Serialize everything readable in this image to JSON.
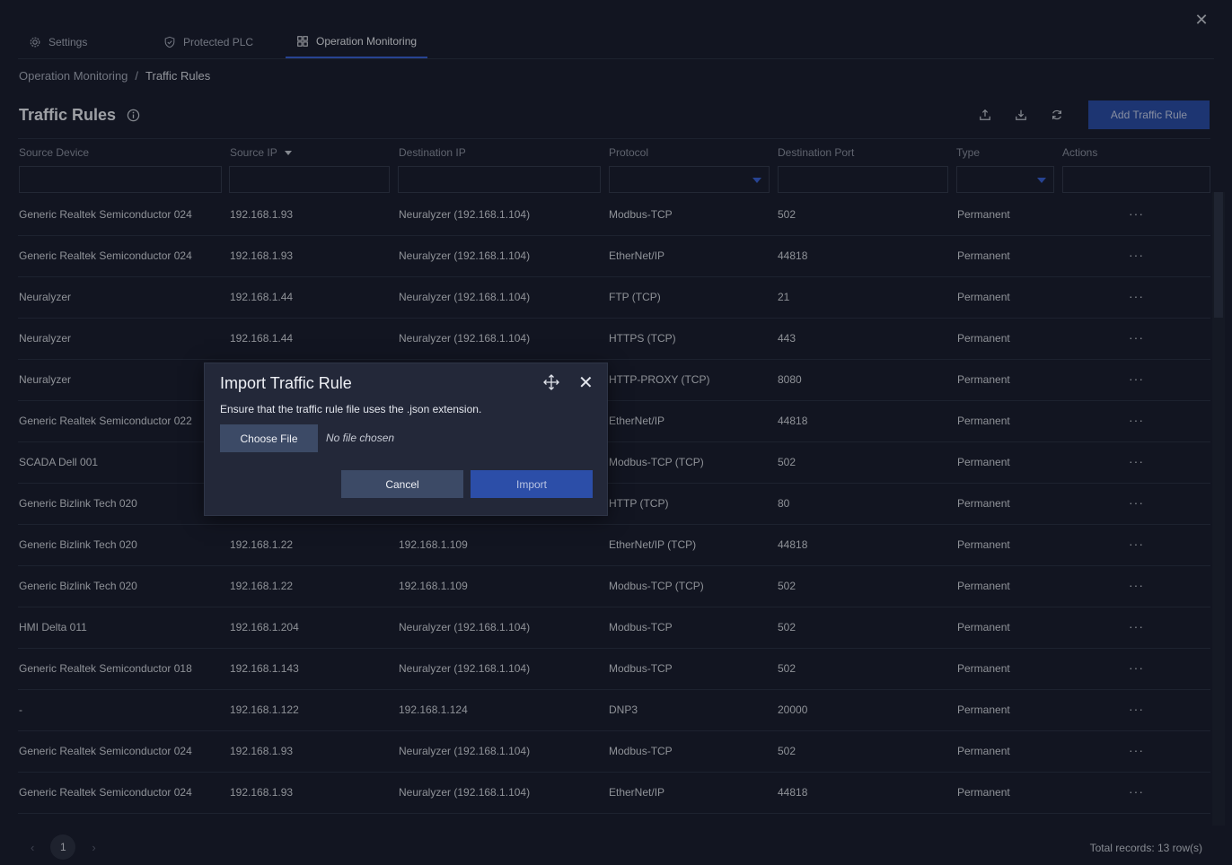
{
  "tabs": [
    {
      "label": "Settings",
      "icon": "gear-icon"
    },
    {
      "label": "Protected PLC",
      "icon": "shield-icon"
    },
    {
      "label": "Operation Monitoring",
      "icon": "grid-icon",
      "active": true
    }
  ],
  "breadcrumb": {
    "parent": "Operation Monitoring",
    "separator": "/",
    "current": "Traffic Rules"
  },
  "page_title": "Traffic Rules",
  "toolbar": {
    "add_label": "Add Traffic Rule",
    "icons": [
      "upload-icon",
      "download-icon",
      "refresh-icon"
    ]
  },
  "table": {
    "columns": [
      "Source Device",
      "Source IP",
      "Destination IP",
      "Protocol",
      "Destination Port",
      "Type",
      "Actions"
    ],
    "rows": [
      [
        "Generic Realtek Semiconductor 024",
        "192.168.1.93",
        "Neuralyzer (192.168.1.104)",
        "Modbus-TCP",
        "502",
        "Permanent"
      ],
      [
        "Generic Realtek Semiconductor 024",
        "192.168.1.93",
        "Neuralyzer (192.168.1.104)",
        "EtherNet/IP",
        "44818",
        "Permanent"
      ],
      [
        "Neuralyzer",
        "192.168.1.44",
        "Neuralyzer (192.168.1.104)",
        "FTP (TCP)",
        "21",
        "Permanent"
      ],
      [
        "Neuralyzer",
        "192.168.1.44",
        "Neuralyzer (192.168.1.104)",
        "HTTPS (TCP)",
        "443",
        "Permanent"
      ],
      [
        "Neuralyzer",
        "",
        "",
        "HTTP-PROXY (TCP)",
        "8080",
        "Permanent"
      ],
      [
        "Generic Realtek Semiconductor 022",
        "",
        "",
        "EtherNet/IP",
        "44818",
        "Permanent"
      ],
      [
        "SCADA Dell 001",
        "",
        "",
        "Modbus-TCP (TCP)",
        "502",
        "Permanent"
      ],
      [
        "Generic Bizlink Tech 020",
        "",
        "",
        "HTTP (TCP)",
        "80",
        "Permanent"
      ],
      [
        "Generic Bizlink Tech 020",
        "192.168.1.22",
        "192.168.1.109",
        "EtherNet/IP (TCP)",
        "44818",
        "Permanent"
      ],
      [
        "Generic Bizlink Tech 020",
        "192.168.1.22",
        "192.168.1.109",
        "Modbus-TCP (TCP)",
        "502",
        "Permanent"
      ],
      [
        "HMI Delta 011",
        "192.168.1.204",
        "Neuralyzer (192.168.1.104)",
        "Modbus-TCP",
        "502",
        "Permanent"
      ],
      [
        "Generic Realtek Semiconductor 018",
        "192.168.1.143",
        "Neuralyzer (192.168.1.104)",
        "Modbus-TCP",
        "502",
        "Permanent"
      ],
      [
        "-",
        "192.168.1.122",
        "192.168.1.124",
        "DNP3",
        "20000",
        "Permanent"
      ],
      [
        "Generic Realtek Semiconductor 024",
        "192.168.1.93",
        "Neuralyzer (192.168.1.104)",
        "Modbus-TCP",
        "502",
        "Permanent"
      ],
      [
        "Generic Realtek Semiconductor 024",
        "192.168.1.93",
        "Neuralyzer (192.168.1.104)",
        "EtherNet/IP",
        "44818",
        "Permanent"
      ]
    ],
    "actions_label": "···"
  },
  "pagination": {
    "current_page": "1",
    "prev": "‹",
    "next": "›"
  },
  "total_records": "Total records: 13 row(s)",
  "dialog": {
    "title": "Import Traffic Rule",
    "message": "Ensure that the traffic rule file uses the .json extension.",
    "choose_file": "Choose File",
    "no_file": "No file chosen",
    "cancel": "Cancel",
    "import": "Import",
    "close": "✕"
  },
  "close_label": "✕",
  "colors": {
    "accent": "#2c4ea8",
    "background": "#1b2031",
    "dialog": "#232839"
  }
}
